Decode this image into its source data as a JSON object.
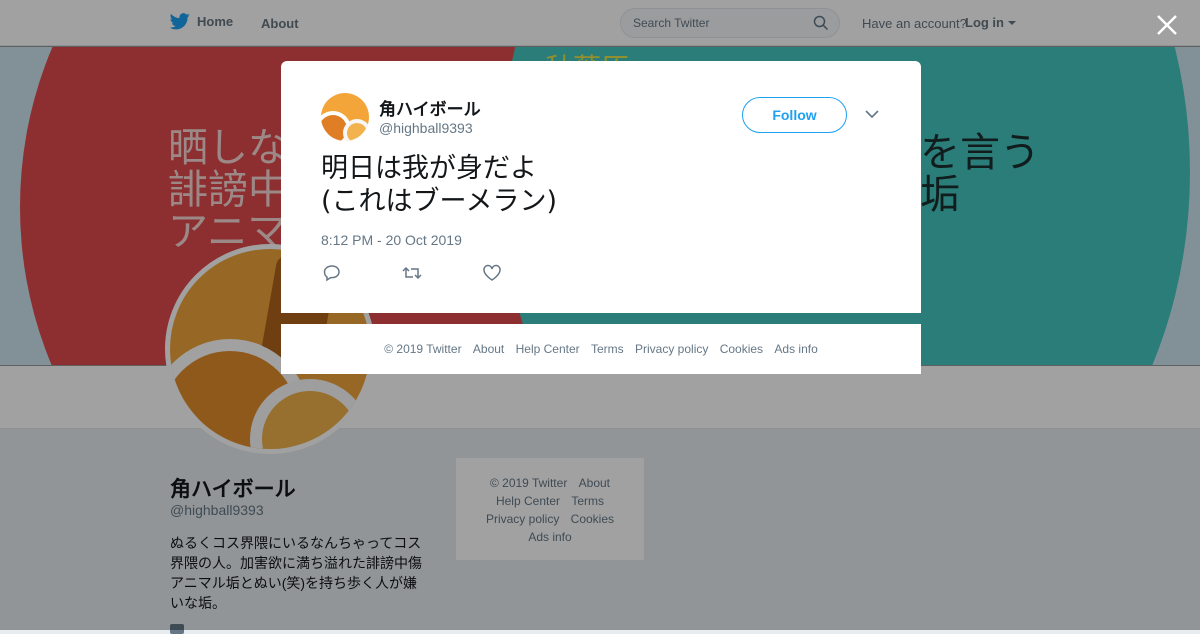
{
  "nav": {
    "home_label": "Home",
    "about_label": "About",
    "search_placeholder": "Search Twitter",
    "have_account": "Have an account?",
    "login_label": "Log in"
  },
  "banner": {
    "left_text": "晒しな\n誹謗中\nアニマ",
    "right_text": "痴を言う\nチ垢",
    "top_text": "秋葉原"
  },
  "profile": {
    "name": "角ハイボール",
    "handle": "@highball9393",
    "bio": "ぬるくコス界隈にいるなんちゃってコス界隈の人。加害欲に満ち溢れた誹謗中傷アニマル垢とぬい(笑)を持ち歩く人が嫌いな垢。"
  },
  "side_footer": {
    "items": [
      "© 2019 Twitter",
      "About",
      "Help Center",
      "Terms",
      "Privacy policy",
      "Cookies",
      "Ads info"
    ]
  },
  "tweet": {
    "name": "角ハイボール",
    "handle": "@highball9393",
    "follow_label": "Follow",
    "text": "明日は我が身だよ\n(これはブーメラン)",
    "timestamp": "8:12 PM - 20 Oct 2019"
  },
  "modal_footer": {
    "items": [
      "© 2019 Twitter",
      "About",
      "Help Center",
      "Terms",
      "Privacy policy",
      "Cookies",
      "Ads info"
    ]
  },
  "colors": {
    "twitter_blue": "#1da1f2",
    "muted_text": "#657786",
    "banner_red": "#e04a4c",
    "banner_teal": "#44c6c2"
  },
  "icons": [
    "twitter-bird-icon",
    "search-icon",
    "caret-down-icon",
    "close-icon",
    "chevron-down-icon",
    "reply-icon",
    "retweet-icon",
    "like-icon"
  ]
}
